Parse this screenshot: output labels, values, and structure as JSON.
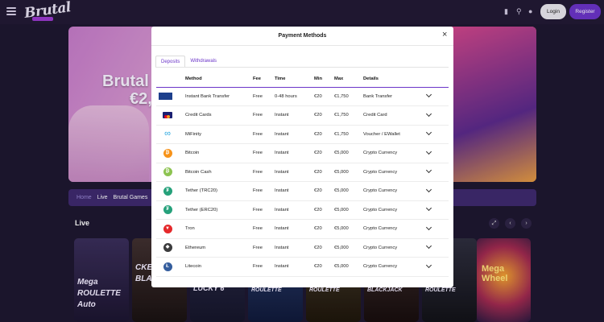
{
  "header": {
    "logo_text": "Brutal",
    "login_label": "Login",
    "register_label": "Register"
  },
  "hero": {
    "text_line1": "Brutal",
    "text_line2": "€2,"
  },
  "subnav": {
    "items": [
      "Home",
      "Live",
      "Brutal Games"
    ]
  },
  "live": {
    "title": "Live"
  },
  "cards": {
    "c1": "Mega ROULETTE Auto",
    "c2": "CKE BLACKJACK",
    "c3": "LUCKY 6",
    "c4": "ROULETTE",
    "c5": "ROULETTE",
    "c6": "BLACKJACK",
    "c7": "ROULETTE",
    "c8": "Mega Wheel"
  },
  "modal": {
    "title": "Payment Methods",
    "close": "×",
    "tabs": [
      "Deposits",
      "Withdrawals"
    ],
    "columns": [
      "Method",
      "Fee",
      "Time",
      "Min",
      "Max",
      "Details"
    ],
    "rows": [
      {
        "method": "Instant Bank Transfer",
        "fee": "Free",
        "time": "0-48 hours",
        "min": "€20",
        "max": "€1,750",
        "details": "Bank Transfer",
        "logo": "instant-banking-logo",
        "color": "#1d3f8c"
      },
      {
        "method": "Credit Cards",
        "fee": "Free",
        "time": "Instant",
        "min": "€20",
        "max": "€1,750",
        "details": "Credit Card",
        "logo": "visa-mastercard-logo",
        "color": "#1a1f71"
      },
      {
        "method": "MiFinity",
        "fee": "Free",
        "time": "Instant",
        "min": "€20",
        "max": "€1,750",
        "details": "Voucher / EWallet",
        "logo": "mifinity-logo",
        "color": "#2aa7df"
      },
      {
        "method": "Bitcoin",
        "fee": "Free",
        "time": "Instant",
        "min": "€20",
        "max": "€5,000",
        "details": "Crypto Currency",
        "logo": "bitcoin-logo",
        "color": "#f7931a"
      },
      {
        "method": "Bitcoin Cash",
        "fee": "Free",
        "time": "Instant",
        "min": "€20",
        "max": "€5,000",
        "details": "Crypto Currency",
        "logo": "bitcoin-cash-logo",
        "color": "#8dc351"
      },
      {
        "method": "Tether (TRC20)",
        "fee": "Free",
        "time": "Instant",
        "min": "€20",
        "max": "€5,000",
        "details": "Crypto Currency",
        "logo": "tether-logo",
        "color": "#26a17b"
      },
      {
        "method": "Tether (ERC20)",
        "fee": "Free",
        "time": "Instant",
        "min": "€20",
        "max": "€5,000",
        "details": "Crypto Currency",
        "logo": "tether-logo",
        "color": "#26a17b"
      },
      {
        "method": "Tron",
        "fee": "Free",
        "time": "Instant",
        "min": "€20",
        "max": "€5,000",
        "details": "Crypto Currency",
        "logo": "tron-logo",
        "color": "#e5292b"
      },
      {
        "method": "Ethereum",
        "fee": "Free",
        "time": "Instant",
        "min": "€20",
        "max": "€5,000",
        "details": "Crypto Currency",
        "logo": "ethereum-logo",
        "color": "#3c3c3d"
      },
      {
        "method": "Litecoin",
        "fee": "Free",
        "time": "Instant",
        "min": "€20",
        "max": "€5,000",
        "details": "Crypto Currency",
        "logo": "litecoin-logo",
        "color": "#345d9d"
      }
    ]
  },
  "colors": {
    "accent": "#6b34c8",
    "background": "#1e1730"
  }
}
